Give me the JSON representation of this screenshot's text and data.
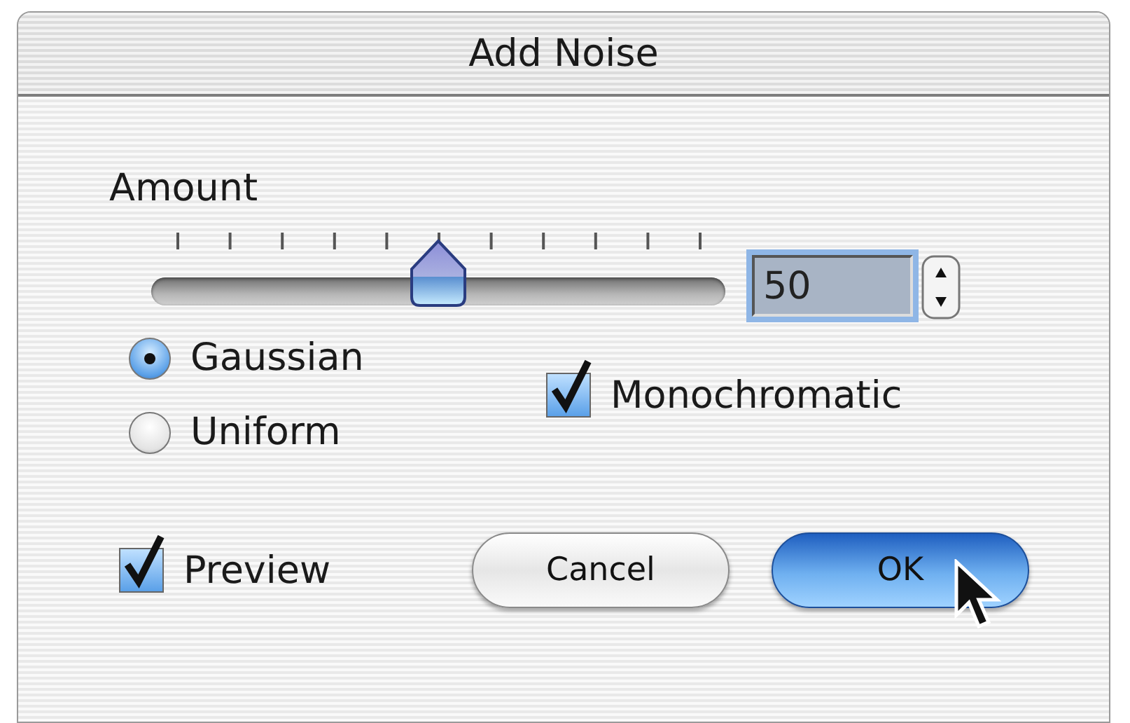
{
  "window": {
    "title": "Add Noise"
  },
  "amount": {
    "label": "Amount",
    "level": 0.5,
    "value": "50",
    "focused": true
  },
  "distribution": [
    {
      "label": "Gaussian",
      "selected": true
    },
    {
      "label": "Uniform",
      "selected": false
    }
  ],
  "monochromatic": {
    "label": "Monochromatic",
    "checked": true
  },
  "preview": {
    "label": "Preview",
    "checked": true
  },
  "buttons": [
    {
      "label": "Cancel",
      "default": false
    },
    {
      "label": "OK",
      "default": true
    }
  ]
}
